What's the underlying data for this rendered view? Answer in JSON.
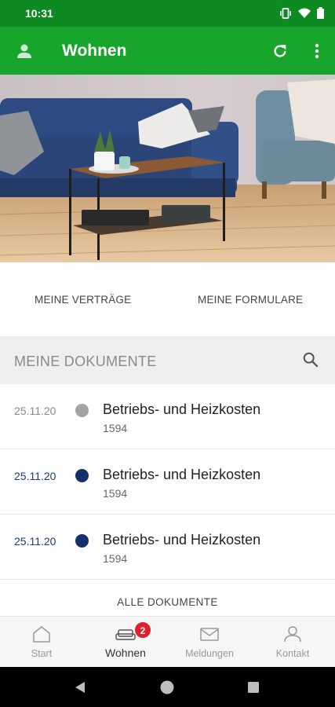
{
  "status_bar": {
    "time": "10:31",
    "icons": [
      "vibrate-icon",
      "wifi-icon",
      "battery-icon"
    ]
  },
  "app_bar": {
    "title": "Wohnen",
    "icons": [
      "account-icon",
      "refresh-icon",
      "more-vert-icon"
    ]
  },
  "quick_links": {
    "contracts": "MEINE VERTRÄGE",
    "forms": "MEINE FORMULARE"
  },
  "documents": {
    "title": "MEINE DOKUMENTE",
    "items": [
      {
        "date": "25.11.20",
        "title": "Betriebs- und Heizkosten",
        "subtitle": "1594",
        "status": "read"
      },
      {
        "date": "25.11.20",
        "title": "Betriebs- und Heizkosten",
        "subtitle": "1594",
        "status": "unread"
      },
      {
        "date": "25.11.20",
        "title": "Betriebs- und Heizkosten",
        "subtitle": "1594",
        "status": "unread"
      }
    ],
    "all_label": "ALLE DOKUMENTE"
  },
  "bottom_nav": {
    "items": [
      {
        "label": "Start",
        "icon": "home-icon"
      },
      {
        "label": "Wohnen",
        "icon": "sofa-icon",
        "badge": "2",
        "active": true
      },
      {
        "label": "Meldungen",
        "icon": "mail-icon"
      },
      {
        "label": "Kontakt",
        "icon": "person-icon"
      }
    ]
  },
  "colors": {
    "status_bar": "#0e8a22",
    "app_bar": "#17a52b",
    "read_dot": "#a3a3a3",
    "unread_dot": "#13306b",
    "badge": "#e0202a"
  }
}
